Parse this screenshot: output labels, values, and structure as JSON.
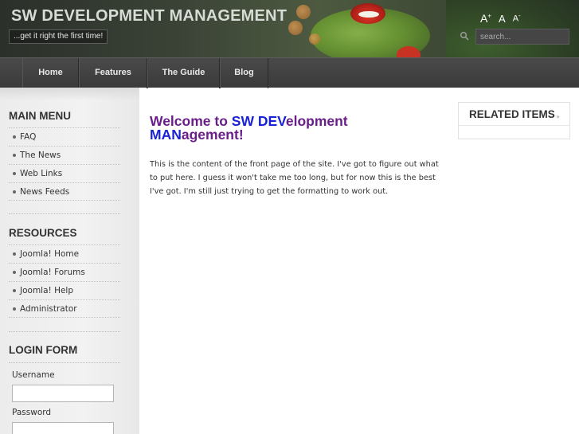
{
  "site": {
    "title": "SW DEVELOPMENT MANAGEMENT",
    "tagline": "...get it right the first time!"
  },
  "font_sizer": {
    "increase": "A",
    "increase_sup": "+",
    "reset": "A",
    "decrease": "A",
    "decrease_sup": "-"
  },
  "search": {
    "placeholder": "search..."
  },
  "nav": {
    "items": [
      {
        "label": "Home"
      },
      {
        "label": "Features"
      },
      {
        "label": "The Guide"
      },
      {
        "label": "Blog"
      }
    ]
  },
  "sidebar": {
    "main_menu": {
      "title": "MAIN MENU",
      "items": [
        "FAQ",
        "The News",
        "Web Links",
        "News Feeds"
      ]
    },
    "resources": {
      "title": "RESOURCES",
      "items": [
        "Joomla! Home",
        "Joomla! Forums",
        "Joomla! Help",
        "Administrator"
      ]
    },
    "login": {
      "title": "LOGIN FORM",
      "username_label": "Username",
      "password_label": "Password"
    }
  },
  "main": {
    "title_parts": [
      "Welcome to ",
      "SW DEV",
      "elopment ",
      "MAN",
      "agement!"
    ],
    "body": "This is the content of the front page of the site. I've got to figure out what to put here. I guess it won't take me too long, but for now this is the best I've got. I'm still just trying to get the formatting to work out."
  },
  "right": {
    "related_title": "RELATED ITEMS"
  },
  "colors": {
    "title_purple": "#6a1e8a",
    "title_blue": "#1a22d6",
    "nav_bg": "#3f3f3f"
  }
}
